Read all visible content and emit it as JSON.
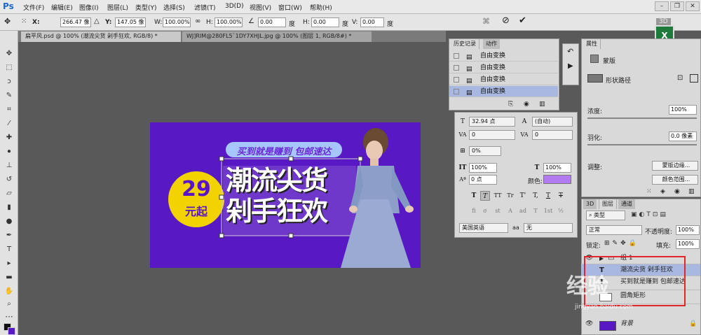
{
  "app": {
    "logo": "Ps"
  },
  "menu": [
    "文件(F)",
    "编辑(E)",
    "图像(I)",
    "图层(L)",
    "类型(Y)",
    "选择(S)",
    "滤镜(T)",
    "3D(D)",
    "视图(V)",
    "窗口(W)",
    "帮助(H)"
  ],
  "window_controls": {
    "minimize": "–",
    "restore": "❐",
    "close": "✕"
  },
  "options": {
    "x_label": "X:",
    "x_value": "266.47 像",
    "y_label": "Y:",
    "y_value": "147.05 像",
    "w_label": "W:",
    "w_value": "100.00%",
    "h_label": "H:",
    "h_value": "100.00%",
    "angle_value": "0.00",
    "angle_unit": "度",
    "hskew_label": "H:",
    "hskew_value": "0.00",
    "hskew_unit": "度",
    "vskew_label": "V:",
    "vskew_value": "0.00",
    "vskew_unit": "度",
    "badge_3d": "3D"
  },
  "doc_tabs": [
    "扁平风.psd @ 100% (潮流尖货  剁手狂欢, RGB/8) *",
    "WJ]RIM@280FL5`1DY7XHJL.jpg @ 100% (图层 1, RGB/8#) *"
  ],
  "canvas": {
    "banner_text": "买到就是赚到 包邮速达",
    "price": "29",
    "price_suffix": "元起",
    "headline_1": "潮流尖货",
    "headline_2": "剁手狂欢"
  },
  "history": {
    "tabs": [
      "历史记录",
      "动作"
    ],
    "rows": [
      "自由变换",
      "自由变换",
      "自由变换",
      "自由变换"
    ]
  },
  "character": {
    "font_size": "32.94 点",
    "leading": "(自动)",
    "kerning": "0",
    "tracking": "0",
    "scale_pct": "0%",
    "vscale": "100%",
    "hscale": "100%",
    "baseline": "0 点",
    "color_label": "颜色:",
    "color": "#b37bf2",
    "style_buttons": [
      "T",
      "T",
      "TT",
      "Tr",
      "T'",
      "T,",
      "T",
      "T"
    ],
    "opentype_buttons": [
      "fi",
      "σ",
      "st",
      "A",
      "ad",
      "T",
      "1st",
      "½"
    ],
    "language": "美国英语",
    "aa_label": "aa",
    "aa_value": "无"
  },
  "properties": {
    "tab": "属性",
    "mask_label": "蒙版",
    "shape_path_label": "形状路径",
    "density_label": "浓度:",
    "density_value": "100%",
    "feather_label": "羽化:",
    "feather_value": "0.0 像素",
    "adjust_label": "调整:",
    "mask_edge_button": "蒙版边缘...",
    "color_range_button": "颜色范围..."
  },
  "layers_panel": {
    "tabs": [
      "3D",
      "图层",
      "通道"
    ],
    "kind_label": "类型",
    "blend_mode": "正常",
    "opacity_label": "不透明度:",
    "opacity_value": "100%",
    "lock_label": "锁定:",
    "fill_label": "填充:",
    "fill_value": "100%",
    "rows": [
      {
        "name": "组 1",
        "selected": false
      },
      {
        "name": "潮流尖货  剁手狂欢",
        "selected": true
      },
      {
        "name": "买到就是赚到 包邮速达",
        "selected": false
      },
      {
        "name": "圆角矩形",
        "selected": false
      },
      {
        "name": "背景",
        "selected": false
      }
    ]
  },
  "watermark": {
    "text": "经验",
    "sub": "jingyan.baidu.com"
  },
  "colors": {
    "canvas_bg": "#5818c3",
    "accent_yellow": "#f2d300",
    "selection_blue": "#a8b8e0",
    "highlight_red": "#e0262b"
  }
}
